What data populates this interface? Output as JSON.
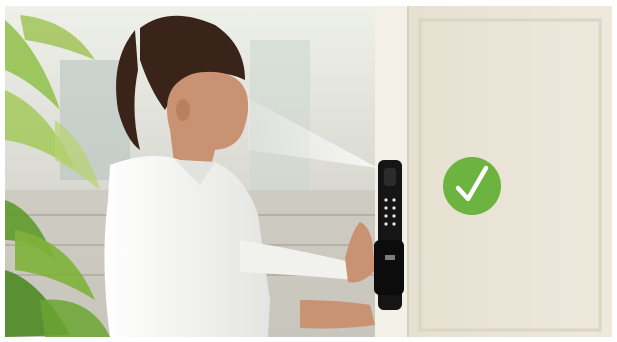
{
  "scene": {
    "icons": {
      "verified": "checkmark-icon",
      "lock": "smart-lock-icon",
      "scan": "face-scan-beam-icon"
    },
    "colors": {
      "background": "#ffffff",
      "wall_left": "#d9d6cc",
      "door": "#ebe6d9",
      "door_frame": "#f3f0e8",
      "shirt": "#f6f6f4",
      "hair": "#3a2419",
      "skin": "#c99273",
      "lock_body": "#151515",
      "badge_green": "#6cb33f",
      "leaf_green": "#7fb13a"
    }
  }
}
